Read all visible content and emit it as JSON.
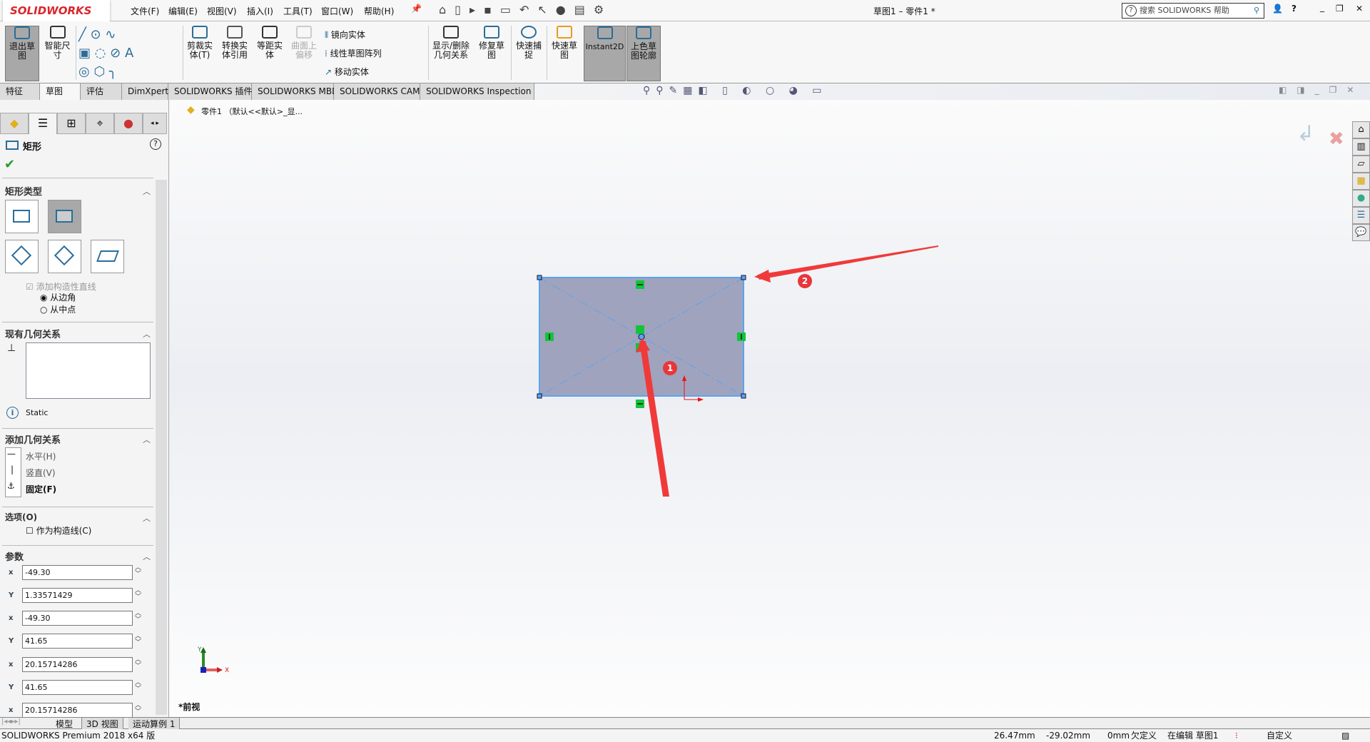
{
  "app": {
    "logo": "SOLIDWORKS",
    "title": "草图1 – 零件1 *",
    "search_placeholder": "搜索 SOLIDWORKS 帮助"
  },
  "menu": [
    "文件(F)",
    "编辑(E)",
    "视图(V)",
    "插入(I)",
    "工具(T)",
    "窗口(W)",
    "帮助(H)"
  ],
  "ribbon": {
    "exit_sketch": "退出草图",
    "smart_dim": "智能尺寸",
    "trim": "剪裁实体(T)",
    "convert": "转换实体引用",
    "offset": "等距实体",
    "surface_offset": "曲面上偏移",
    "mirror": "镜向实体",
    "linear_pattern": "线性草图阵列",
    "move": "移动实体",
    "show_relations": "显示/删除几何关系",
    "repair": "修复草图",
    "quick_snap": "快速捕捉",
    "rapid_sketch": "快速草图",
    "instant2d": "Instant2D",
    "shaded": "上色草图轮廓"
  },
  "tabs": [
    "特征",
    "草图",
    "评估",
    "DimXpert",
    "SOLIDWORKS 插件",
    "SOLIDWORKS MBD",
    "SOLIDWORKS CAM",
    "SOLIDWORKS Inspection"
  ],
  "active_tab": "草图",
  "tree": {
    "root": "零件1 （默认<<默认>_显..."
  },
  "panel": {
    "title": "矩形",
    "sections": {
      "type": "矩形类型",
      "existing": "现有几何关系",
      "add": "添加几何关系",
      "options": "选项(O)",
      "params": "参数"
    },
    "add_construction": "添加构造性直线",
    "radio_corner": "从边角",
    "radio_mid": "从中点",
    "radio_selected": "从边角",
    "status": "Static",
    "relations": [
      "水平(H)",
      "竖直(V)",
      "固定(F)"
    ],
    "as_construction": "作为构造线(C)",
    "params": [
      {
        "axis": "x",
        "value": "-49.30"
      },
      {
        "axis": "Y",
        "value": "1.33571429"
      },
      {
        "axis": "x",
        "value": "-49.30"
      },
      {
        "axis": "Y",
        "value": "41.65"
      },
      {
        "axis": "x",
        "value": "20.15714286"
      },
      {
        "axis": "Y",
        "value": "41.65"
      },
      {
        "axis": "x",
        "value": "20.15714286"
      }
    ]
  },
  "view": {
    "name": "*前视",
    "axis_x": "X",
    "axis_y": "Y",
    "callouts": [
      "1",
      "2"
    ]
  },
  "bottom_tabs": [
    "模型",
    "3D 视图",
    "运动算例 1"
  ],
  "status": {
    "product": "SOLIDWORKS Premium 2018 x64 版",
    "x": "26.47mm",
    "y": "-29.02mm",
    "z": "0mm",
    "state": "欠定义",
    "editing": "在编辑 草图1",
    "units": "自定义"
  }
}
